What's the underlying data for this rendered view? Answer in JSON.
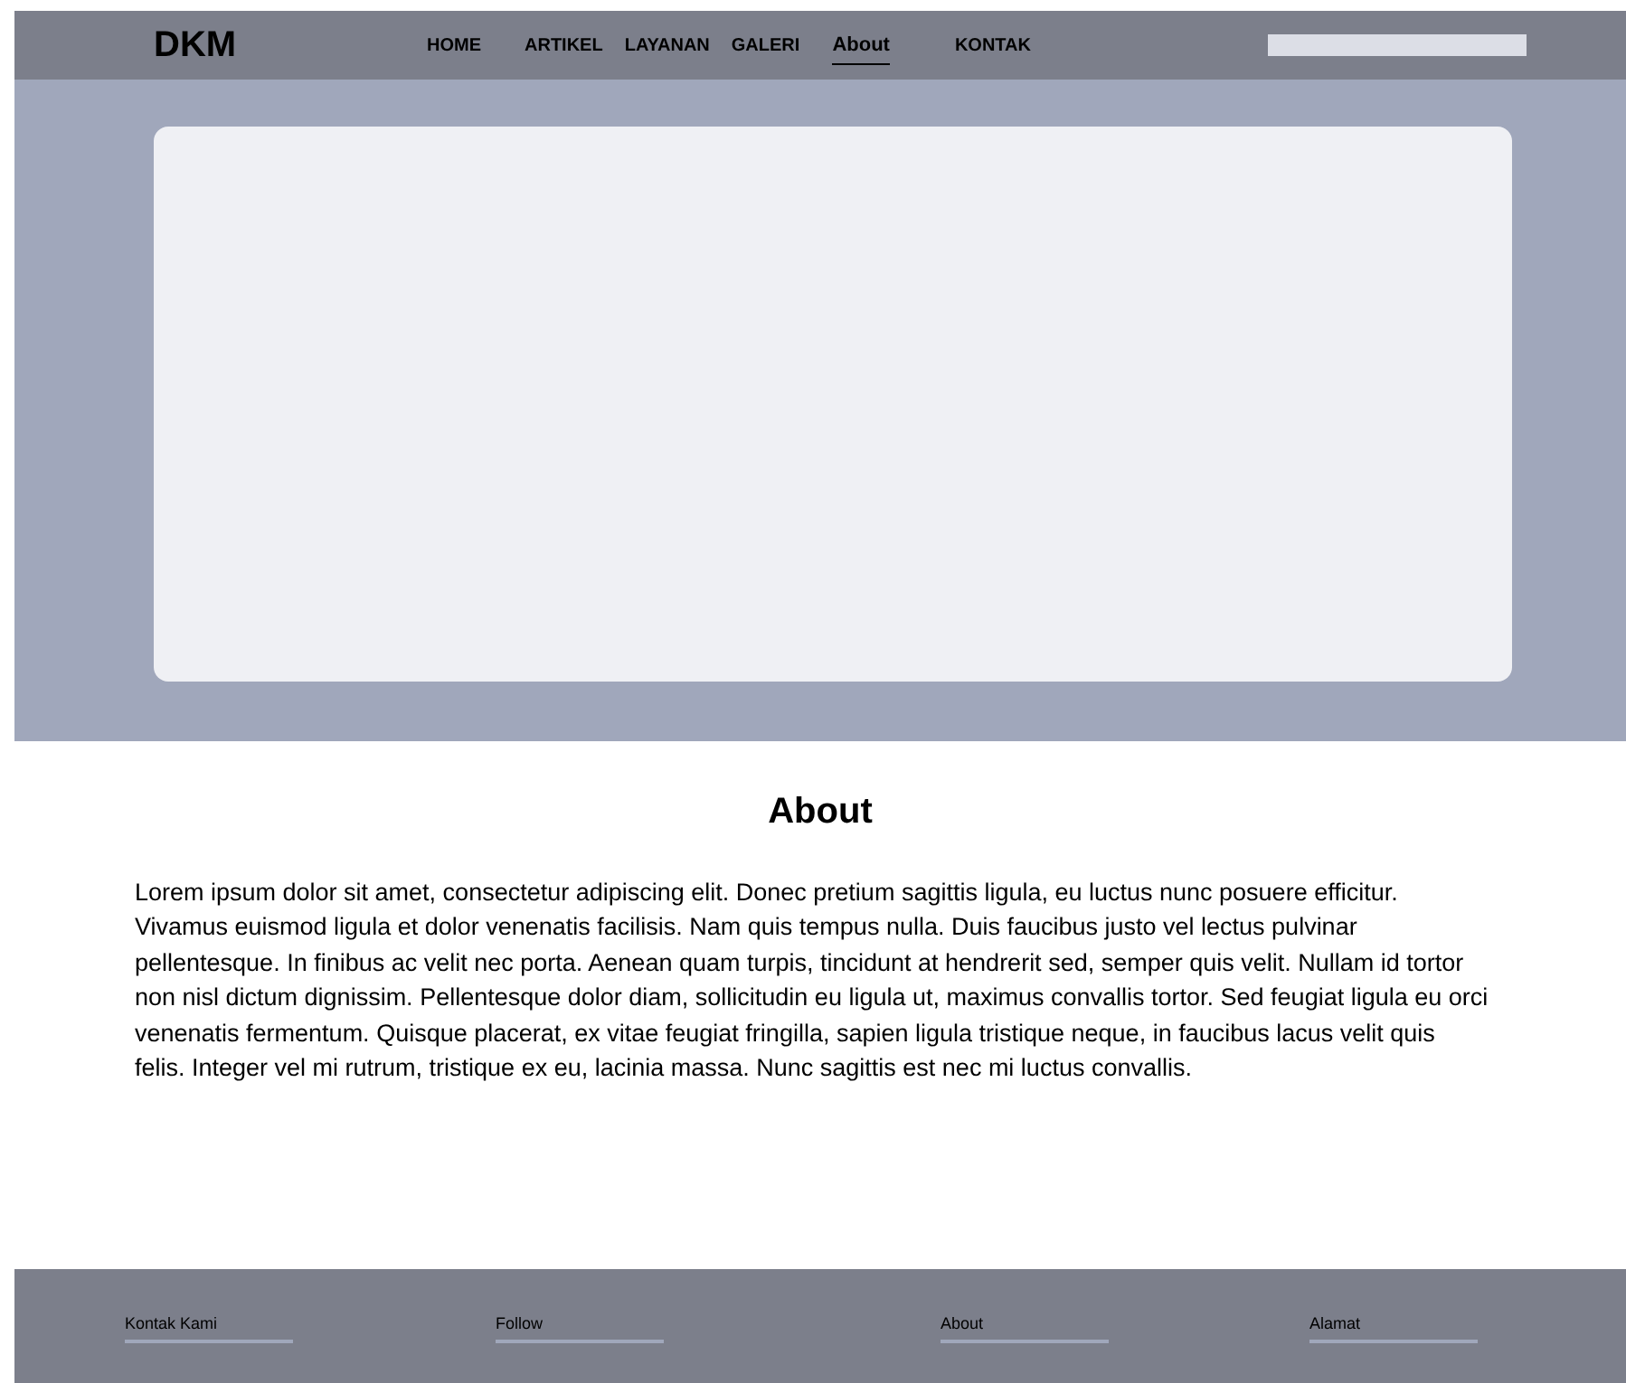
{
  "header": {
    "logo": "DKM",
    "nav": [
      {
        "label": "HOME",
        "selected": false
      },
      {
        "label": "ARTIKEL",
        "selected": false
      },
      {
        "label": "LAYANAN",
        "selected": false
      },
      {
        "label": "GALERI",
        "selected": false
      },
      {
        "label": "About",
        "selected": true
      },
      {
        "label": "KONTAK",
        "selected": false
      }
    ]
  },
  "about": {
    "title": "About",
    "body": "Lorem ipsum dolor sit amet, consectetur adipiscing elit. Donec pretium sagittis ligula, eu luctus nunc posuere efficitur. Vivamus euismod ligula et dolor venenatis facilisis. Nam quis tempus nulla. Duis faucibus justo vel lectus pulvinar pellentesque. In finibus ac velit nec porta. Aenean quam turpis, tincidunt at hendrerit sed, semper quis velit. Nullam id tortor non nisl dictum dignissim. Pellentesque dolor diam, sollicitudin eu ligula ut, maximus convallis tortor. Sed feugiat ligula eu orci venenatis fermentum. Quisque placerat, ex vitae feugiat fringilla, sapien ligula tristique neque, in faucibus lacus velit quis felis. Integer vel mi rutrum, tristique ex eu, lacinia massa. Nunc sagittis est nec mi luctus convallis."
  },
  "footer": {
    "headings": [
      "Kontak Kami",
      "Follow",
      "About",
      "Alamat"
    ]
  }
}
